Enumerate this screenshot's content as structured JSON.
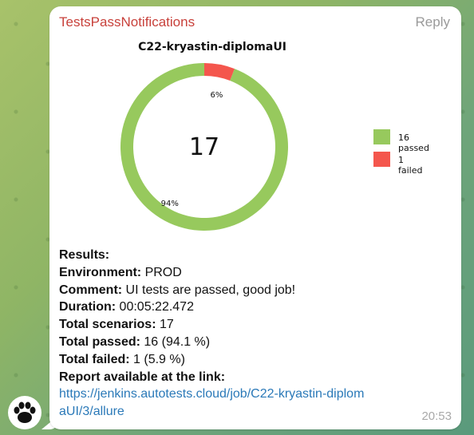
{
  "message": {
    "sender": "TestsPassNotifications",
    "reply_label": "Reply",
    "time": "20:53"
  },
  "chart_data": {
    "type": "pie",
    "title": "C22-kryastin-diplomaUI",
    "center_value": "17",
    "categories": [
      "passed",
      "failed"
    ],
    "values": [
      16,
      1
    ],
    "percent_labels": [
      "94%",
      "6%"
    ],
    "legend": [
      "16 passed",
      "1 failed"
    ],
    "colors": [
      "#97c95d",
      "#f4564d"
    ],
    "legend_placement": "right"
  },
  "results": {
    "header": "Results:",
    "environment_label": "Environment:",
    "environment_value": " PROD",
    "comment_label": "Comment:",
    "comment_value": " UI tests are passed, good job!",
    "duration_label": "Duration:",
    "duration_value": " 00:05:22.472",
    "total_scenarios_label": "Total scenarios:",
    "total_scenarios_value": " 17",
    "total_passed_label": "Total passed:",
    "total_passed_value": " 16 (94.1 %)",
    "total_failed_label": "Total failed:",
    "total_failed_value": " 1 (5.9 %)",
    "report_label": "Report available at the link:",
    "report_link": "https://jenkins.autotests.cloud/job/C22-kryastin-diplomaUI/3/allure"
  },
  "icons": {
    "avatar": "paw-icon"
  }
}
